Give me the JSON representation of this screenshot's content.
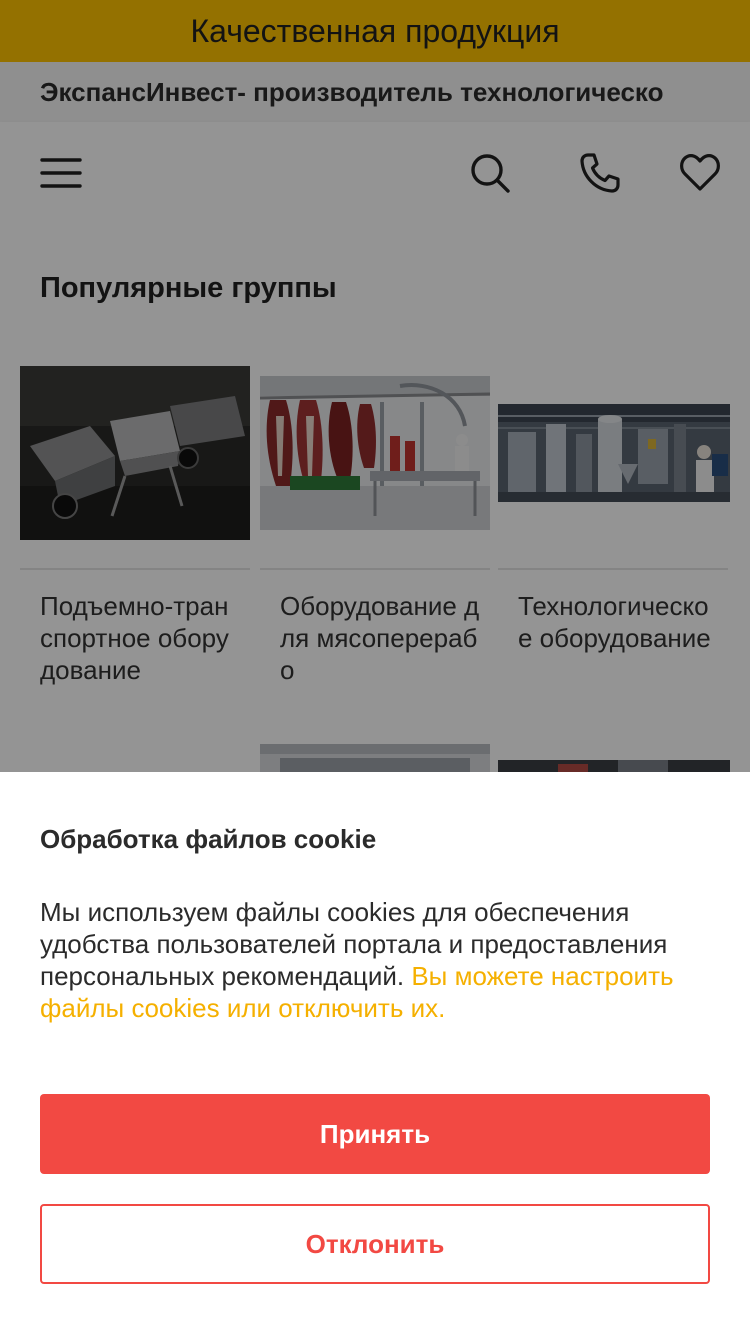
{
  "promo": {
    "text": "Качественная продукция"
  },
  "company": {
    "text": "ЭкспансИнвест- производитель технологическо"
  },
  "header": {
    "menu_icon": "hamburger-menu-icon",
    "search_icon": "search-icon",
    "phone_icon": "phone-icon",
    "favorites_icon": "heart-icon"
  },
  "popular": {
    "title": "Популярные группы",
    "cards": [
      {
        "label": "Подъемно-транспортное оборудование",
        "image": "metal-trolleys-photo"
      },
      {
        "label": "Оборудование для мясоперерабо",
        "image": "meat-processing-line-photo"
      },
      {
        "label": "Технологическое оборудование",
        "image": "industrial-tanks-photo"
      }
    ]
  },
  "cookie": {
    "title": "Обработка файлов cookie",
    "text": "Мы используем файлы cookies для обеспечения удобства пользователей портала и предоставления персональных рекомендаций.",
    "link": "Вы можете настроить файлы cookies или отключить их.",
    "accept": "Принять",
    "decline": "Отклонить"
  },
  "colors": {
    "promo_bg": "#ffc300",
    "accent_red": "#f24943",
    "link_yellow": "#f5b000"
  }
}
